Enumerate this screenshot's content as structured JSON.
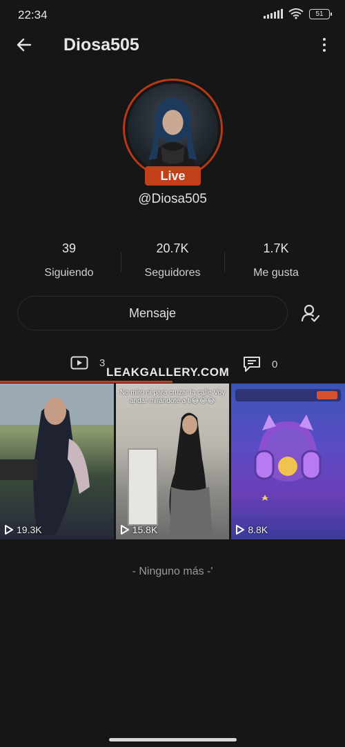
{
  "status_bar": {
    "time": "22:34",
    "battery": "51"
  },
  "header": {
    "title": "Diosa505",
    "back_icon": "arrow-left-icon",
    "more_icon": "more-vertical-icon"
  },
  "profile": {
    "live_label": "Live",
    "username": "@Diosa505",
    "accent_color": "#c0401a"
  },
  "stats": [
    {
      "value": "39",
      "label": "Siguiendo"
    },
    {
      "value": "20.7K",
      "label": "Seguidores"
    },
    {
      "value": "1.7K",
      "label": "Me gusta"
    }
  ],
  "actions": {
    "message_label": "Mensaje",
    "friend_icon": "user-check-icon"
  },
  "tabs": {
    "videos_count": "3",
    "comments_count": "0",
    "watermark": "LEAKGALLERY.COM"
  },
  "videos": [
    {
      "views": "19.3K",
      "overlay": ""
    },
    {
      "views": "15.8K",
      "overlay": "No miro ni para cruzar la calle Voy andar mirándote a ti😂😂😂"
    },
    {
      "views": "8.8K",
      "overlay": ""
    }
  ],
  "footer": {
    "end_text": "- Ninguno más -'"
  }
}
